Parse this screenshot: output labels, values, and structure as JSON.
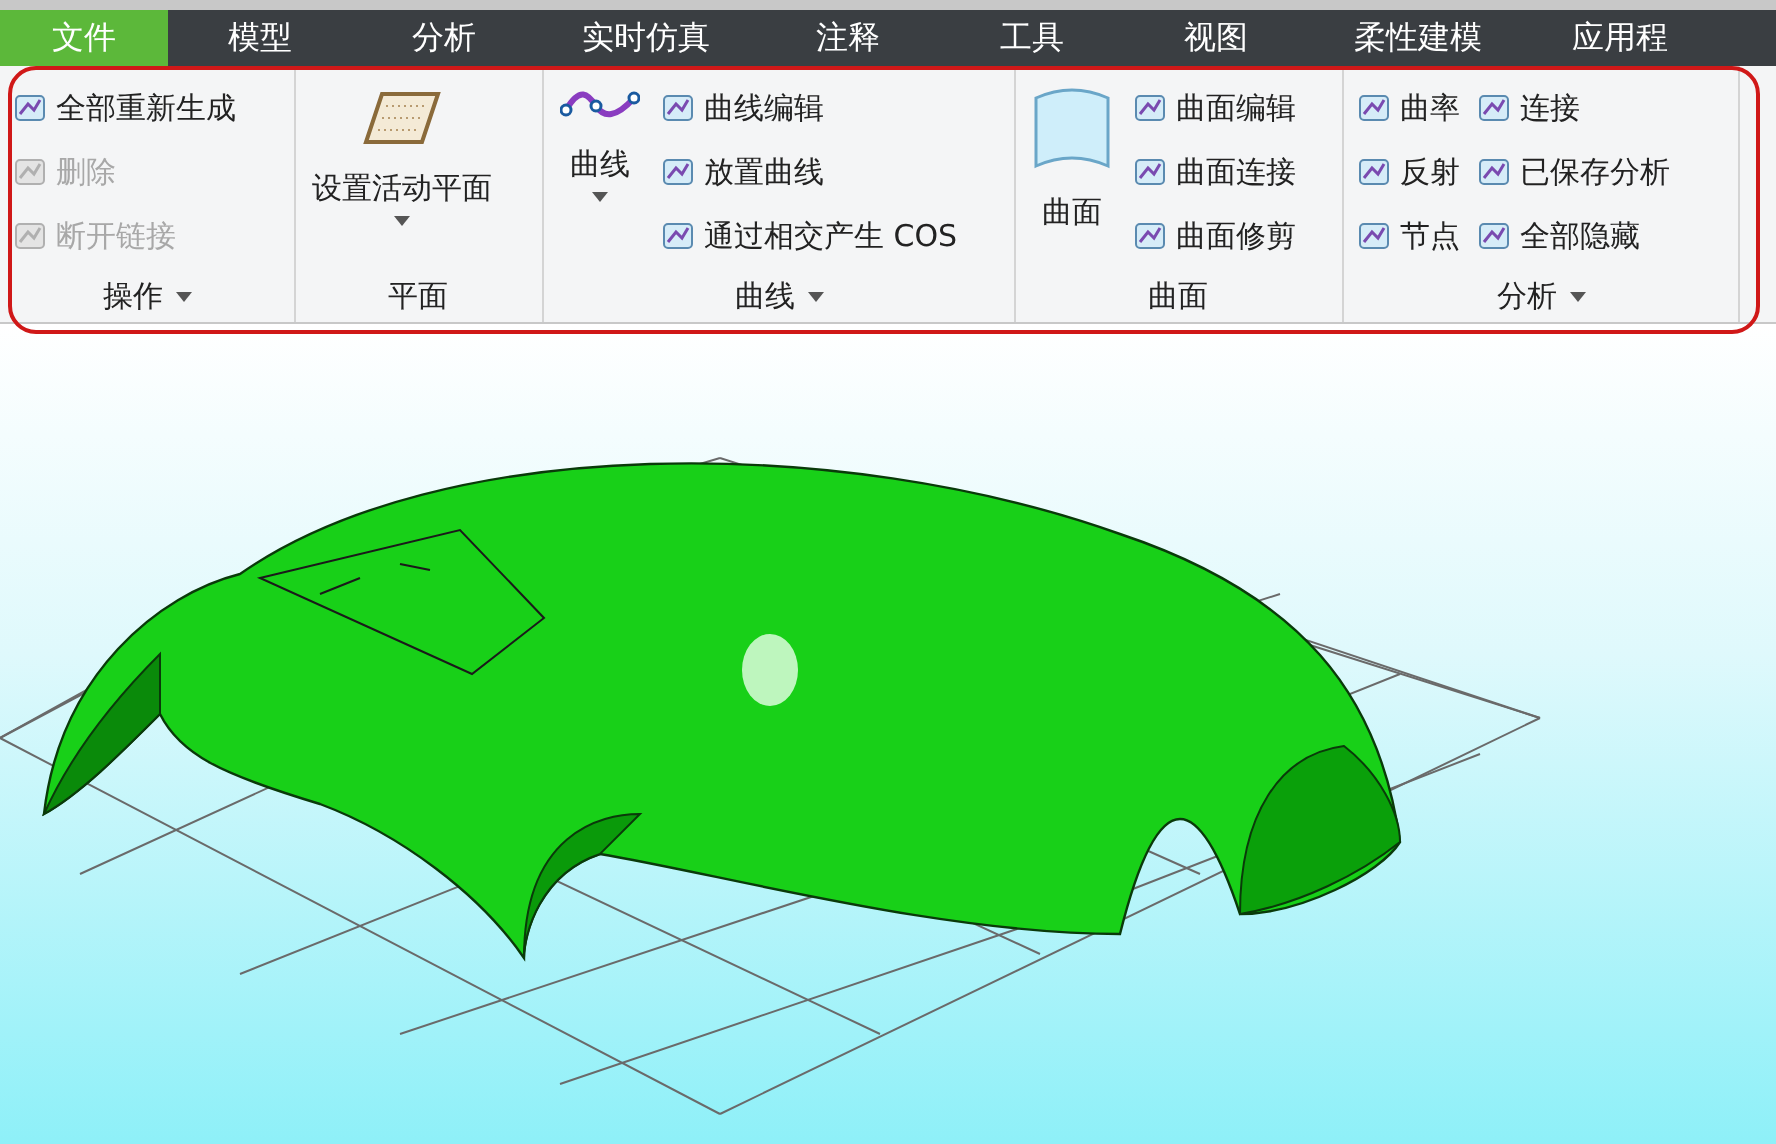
{
  "tabs": [
    {
      "label": "文件",
      "selected": true
    },
    {
      "label": "模型",
      "selected": false
    },
    {
      "label": "分析",
      "selected": false
    },
    {
      "label": "实时仿真",
      "selected": false
    },
    {
      "label": "注释",
      "selected": false
    },
    {
      "label": "工具",
      "selected": false
    },
    {
      "label": "视图",
      "selected": false
    },
    {
      "label": "柔性建模",
      "selected": false
    },
    {
      "label": "应用程",
      "selected": false
    }
  ],
  "groups": [
    {
      "label": "操作",
      "has_menu": true,
      "small": [
        {
          "label": "全部重新生成",
          "disabled": false
        },
        {
          "label": "删除",
          "disabled": true
        },
        {
          "label": "断开链接",
          "disabled": true
        }
      ]
    },
    {
      "label": "平面",
      "has_menu": false,
      "large": [
        {
          "label": "设置活动平面",
          "has_menu": true
        }
      ]
    },
    {
      "label": "曲线",
      "has_menu": true,
      "large": [
        {
          "label": "曲线",
          "has_menu": true
        }
      ],
      "small": [
        {
          "label": "曲线编辑",
          "disabled": false
        },
        {
          "label": "放置曲线",
          "disabled": false
        },
        {
          "label": "通过相交产生 COS",
          "disabled": false
        }
      ]
    },
    {
      "label": "曲面",
      "has_menu": false,
      "large": [
        {
          "label": "曲面",
          "has_menu": false
        }
      ],
      "small": [
        {
          "label": "曲面编辑",
          "disabled": false
        },
        {
          "label": "曲面连接",
          "disabled": false
        },
        {
          "label": "曲面修剪",
          "disabled": false
        }
      ]
    },
    {
      "label": "分析",
      "has_menu": true,
      "small": [
        {
          "label": "曲率",
          "disabled": false
        },
        {
          "label": "反射",
          "disabled": false
        },
        {
          "label": "节点",
          "disabled": false
        },
        {
          "label": "连接",
          "disabled": false
        },
        {
          "label": "已保存分析",
          "disabled": false
        },
        {
          "label": "全部隐藏",
          "disabled": false
        }
      ]
    }
  ]
}
